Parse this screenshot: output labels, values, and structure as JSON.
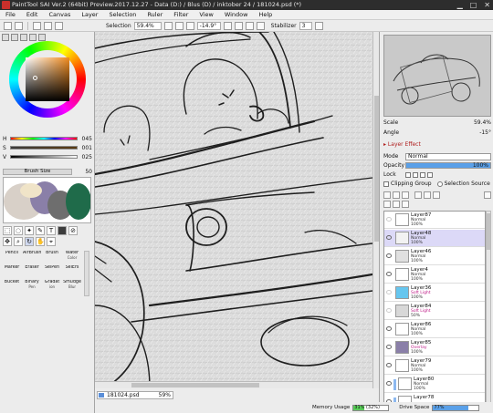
{
  "window": {
    "title": "PaintTool SAI Ver.2 (64bit) Preview.2017.12.27 - Data (D:) / Blus (D) / inktober 24 / 181024.psd (*)",
    "controls": [
      "▁",
      "□",
      "✕"
    ]
  },
  "menu": [
    "File",
    "Edit",
    "Canvas",
    "Layer",
    "Selection",
    "Ruler",
    "Filter",
    "View",
    "Window",
    "Help"
  ],
  "toolbar": {
    "selection_label": "Selection",
    "zoom": "59.4%",
    "rotation": "-14.9°",
    "stabilizer_label": "Stabilizer",
    "stabilizer_value": "3"
  },
  "color": {
    "rows": [
      {
        "key": "H",
        "value": "045"
      },
      {
        "key": "S",
        "value": "001"
      },
      {
        "key": "V",
        "value": "025"
      }
    ],
    "brush_size_label": "Brush Size",
    "brush_size_value": "50"
  },
  "brushes": [
    {
      "name": "Pencil",
      "sub": ""
    },
    {
      "name": "AirBrush",
      "sub": ""
    },
    {
      "name": "Brush",
      "sub": ""
    },
    {
      "name": "Water",
      "sub": "Color"
    },
    {
      "name": "Marker",
      "sub": ""
    },
    {
      "name": "Eraser",
      "sub": ""
    },
    {
      "name": "SelPen",
      "sub": ""
    },
    {
      "name": "SelErs",
      "sub": ""
    },
    {
      "name": "Bucket",
      "sub": ""
    },
    {
      "name": "Binary",
      "sub": "Pen"
    },
    {
      "name": "Gradat",
      "sub": "ion"
    },
    {
      "name": "Smudge",
      "sub": "Blur"
    }
  ],
  "document": {
    "tab_name": "181024.psd",
    "tab_zoom": "59%"
  },
  "navigator": {
    "scale_label": "Scale",
    "scale_value": "59.4%",
    "angle_label": "Angle",
    "angle_value": "-15°"
  },
  "layer_panel": {
    "effect_label": "Layer Effect",
    "mode_label": "Mode",
    "mode_value": "Normal",
    "opacity_label": "Opacity",
    "opacity_value": "100%",
    "opacity_fraction": 1.0,
    "lock_label": "Lock",
    "clipping_label": "Clipping Group",
    "selection_source_label": "Selection Source"
  },
  "layers": [
    {
      "name": "Layer87",
      "mode": "Normal",
      "opacity": "100%",
      "visible": false,
      "selected": false,
      "clip": false,
      "thumb": "#ffffff"
    },
    {
      "name": "Layer48",
      "mode": "Normal",
      "opacity": "100%",
      "visible": true,
      "selected": true,
      "clip": false,
      "thumb": "#f2f2f2"
    },
    {
      "name": "Layer46",
      "mode": "Normal",
      "opacity": "100%",
      "visible": true,
      "selected": false,
      "clip": false,
      "thumb": "#e0e0e0"
    },
    {
      "name": "Layer4",
      "mode": "Normal",
      "opacity": "100%",
      "visible": true,
      "selected": false,
      "clip": false,
      "thumb": "#ffffff"
    },
    {
      "name": "Layer36",
      "mode": "Soft Light",
      "opacity": "100%",
      "visible": false,
      "selected": false,
      "clip": false,
      "thumb": "#66c6ef"
    },
    {
      "name": "Layer84",
      "mode": "Soft Light",
      "opacity": "50%",
      "visible": false,
      "selected": false,
      "clip": false,
      "thumb": "#d8d8d8"
    },
    {
      "name": "Layer86",
      "mode": "Normal",
      "opacity": "100%",
      "visible": true,
      "selected": false,
      "clip": false,
      "thumb": "#ffffff"
    },
    {
      "name": "Layer85",
      "mode": "Overlay",
      "opacity": "100%",
      "visible": true,
      "selected": false,
      "clip": false,
      "thumb": "#8a7fa8"
    },
    {
      "name": "Layer79",
      "mode": "Normal",
      "opacity": "100%",
      "visible": true,
      "selected": false,
      "clip": false,
      "thumb": "#ffffff"
    },
    {
      "name": "Layer80",
      "mode": "Normal",
      "opacity": "100%",
      "visible": true,
      "selected": false,
      "clip": true,
      "thumb": "#ffffff"
    },
    {
      "name": "Layer78",
      "mode": "",
      "opacity": "",
      "visible": true,
      "selected": false,
      "clip": true,
      "thumb": "#ffffff"
    }
  ],
  "status": {
    "memory_label": "Memory Usage",
    "memory_value": "31% (32%)",
    "memory_fraction": 0.31,
    "drive_label": "Drive Space",
    "drive_value": "77%",
    "drive_fraction": 0.77
  },
  "colors": {
    "accent": "#5aa0e8",
    "selected_layer": "#dcd9f7",
    "memory_fill": "#5ad05a",
    "drive_fill": "#5aa0e8",
    "current_color": "#3c3c3c"
  },
  "icons": [
    "app-icon",
    "pen-icon",
    "select-arrow-icon",
    "move-icon",
    "zoom-icon",
    "rotate-icon",
    "hand-icon",
    "eyedropper-icon",
    "text-icon",
    "eye-icon",
    "new-layer-icon",
    "trash-icon"
  ]
}
